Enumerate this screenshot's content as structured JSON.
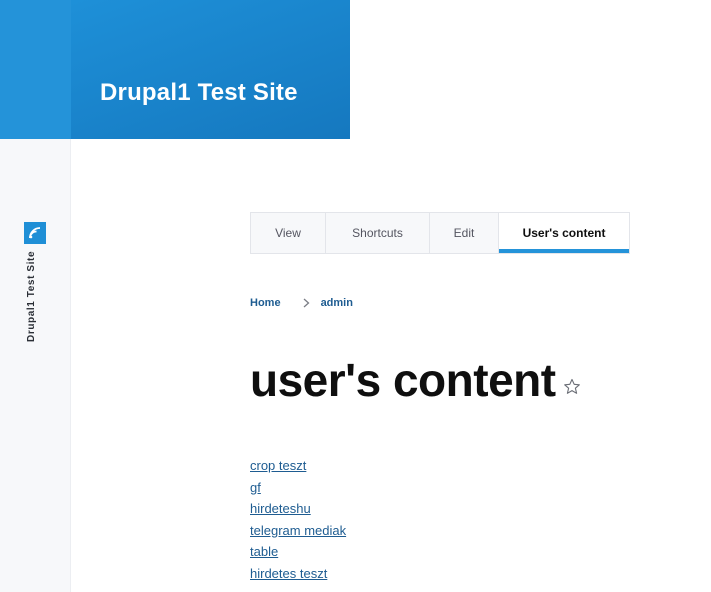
{
  "site": {
    "name": "Drupal1 Test Site",
    "rail_name": "Drupal1 Test Site",
    "accent": "#2493d9"
  },
  "tabs": [
    {
      "label": "View",
      "active": false
    },
    {
      "label": "Shortcuts",
      "active": false
    },
    {
      "label": "Edit",
      "active": false
    },
    {
      "label": "User's content",
      "active": true
    }
  ],
  "breadcrumb": [
    {
      "label": "Home"
    },
    {
      "label": "admin"
    }
  ],
  "page": {
    "title": "user's content"
  },
  "icons": {
    "rail_logo": "drupal-logo-icon",
    "separator": "chevron-right-icon",
    "shortcut": "star-outline-icon"
  },
  "content_items": [
    {
      "label": "crop teszt"
    },
    {
      "label": "gf"
    },
    {
      "label": "hirdeteshu"
    },
    {
      "label": "telegram mediak"
    },
    {
      "label": "table"
    },
    {
      "label": "hirdetes teszt"
    }
  ]
}
